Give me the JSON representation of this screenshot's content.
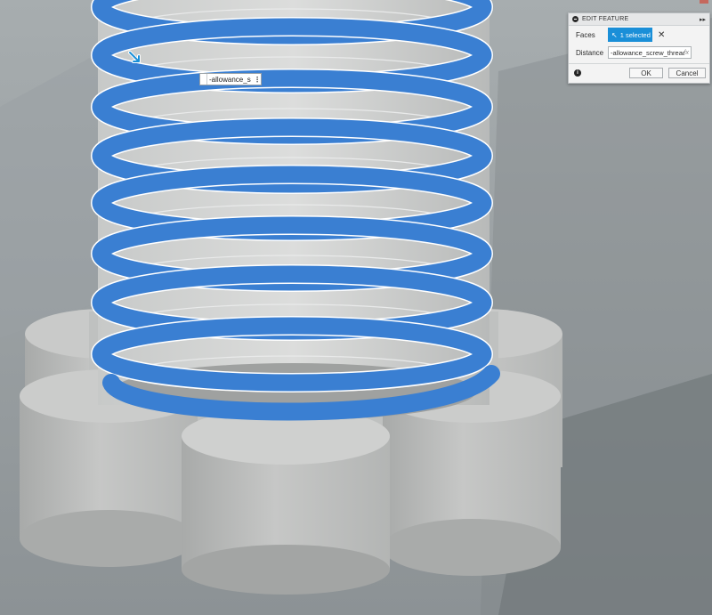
{
  "viewport": {
    "inline_input": {
      "value": "-allowance_s",
      "more_icon": "more-vertical-icon"
    },
    "manipulator_icon": "push-arrow-icon"
  },
  "dialog": {
    "title": "EDIT FEATURE",
    "faces_label": "Faces",
    "faces_value": "1 selected",
    "distance_label": "Distance",
    "distance_value": "-allowance_screw_thread",
    "fx_label": "fx",
    "ok_label": "OK",
    "cancel_label": "Cancel"
  },
  "colors": {
    "selection_blue": "#3a7fd2",
    "dialog_accent": "#1a8fd8",
    "body_gray": "#bcbebd",
    "background": "#8f9598"
  }
}
